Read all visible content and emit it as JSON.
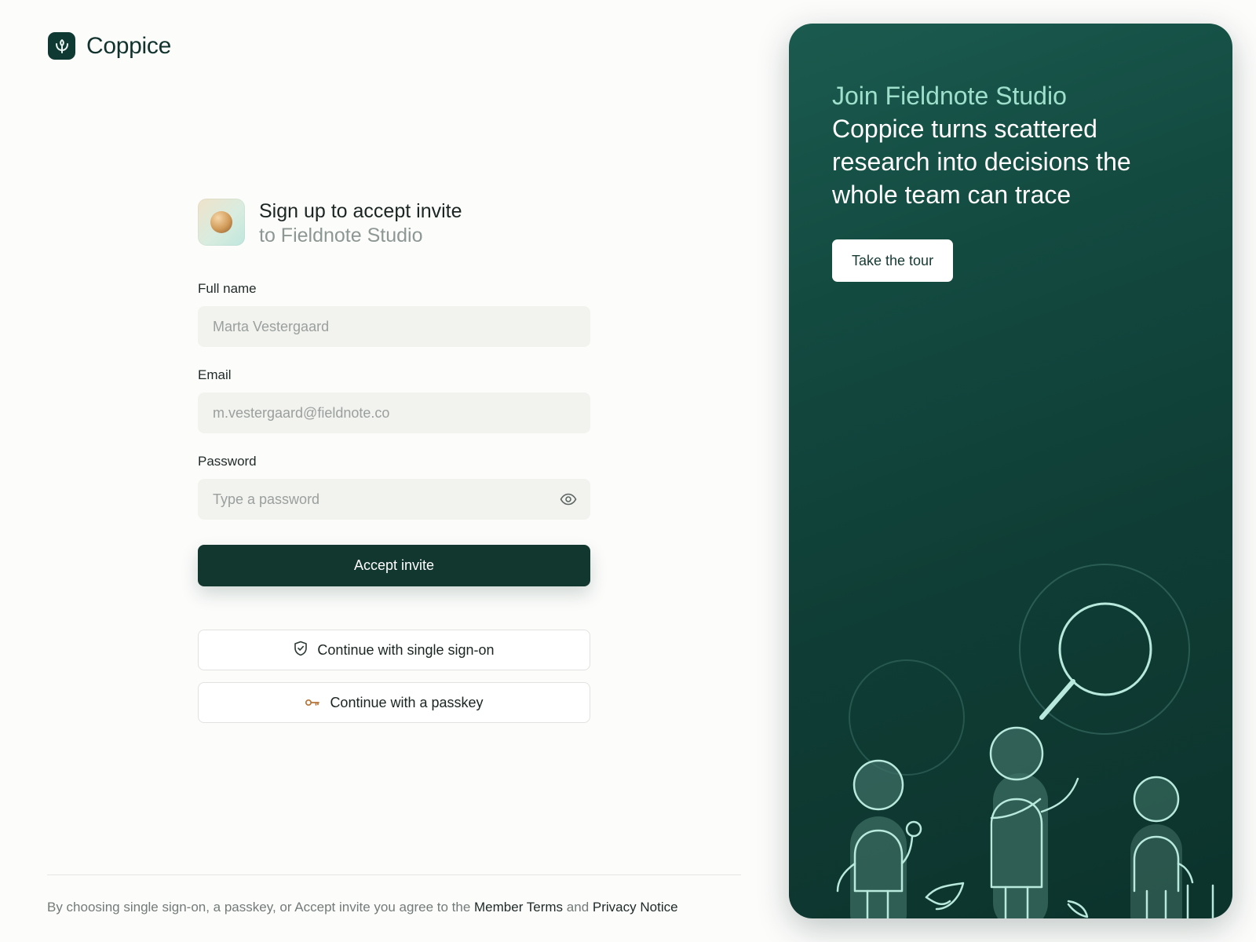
{
  "brand": {
    "name": "Coppice",
    "logo_icon": "sprout-icon"
  },
  "invite": {
    "title": "Sign up to accept invite",
    "subtitle": "to Fieldnote Studio",
    "workspace_icon": "workspace-orb-icon"
  },
  "form": {
    "full_name": {
      "label": "Full name",
      "placeholder": "Marta Vestergaard"
    },
    "email": {
      "label": "Email",
      "placeholder": "m.vestergaard@fieldnote.co"
    },
    "password": {
      "label": "Password",
      "placeholder": "Type a password",
      "toggle_icon": "eye-icon"
    },
    "submit_label": "Accept invite",
    "sso_label": "Continue with single sign-on",
    "sso_icon": "shield-check-icon",
    "passkey_label": "Continue with a passkey",
    "passkey_icon": "key-icon"
  },
  "legal": {
    "prefix": "By choosing single sign-on, a passkey, or Accept invite you agree to the",
    "terms_link": "Member Terms",
    "conjunction": "and",
    "privacy_link": "Privacy Notice"
  },
  "panel": {
    "kicker": "Join Fieldnote Studio",
    "headline": "Coppice turns scattered research into decisions the whole team can trace",
    "cta_label": "Take the tour",
    "illustration": "research-team-magnifier-illustration"
  },
  "colors": {
    "primary": "#12372f",
    "panel_bg": "#0f3d35",
    "accent_text": "#9fe0cc",
    "passkey_icon": "#b5763a"
  }
}
